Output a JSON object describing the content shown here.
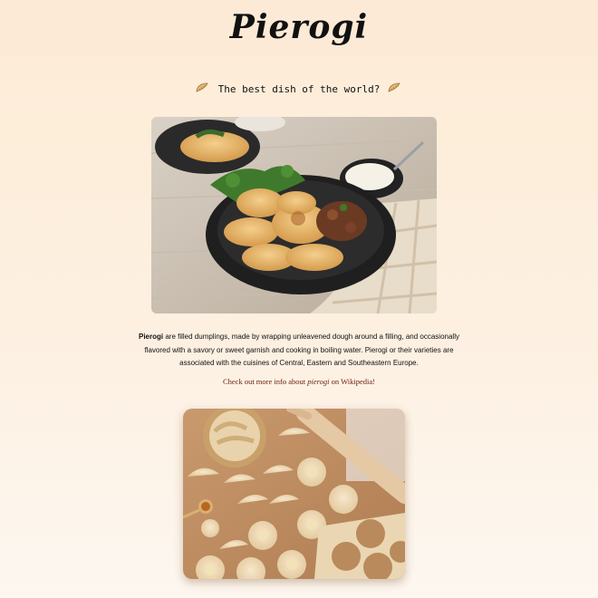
{
  "header": {
    "title": "Pierogi"
  },
  "tagline": {
    "text": "The best dish of the world?",
    "icon_left": "dumpling-icon",
    "icon_right": "dumpling-icon"
  },
  "images": {
    "top": "pierogi-bowl-photo",
    "bottom": "dough-preparation-photo"
  },
  "description": {
    "bold_term": "Pierogi",
    "text": " are filled dumplings, made by wrapping unleavened dough around a filling, and occasionally flavored with a savory or sweet garnish and cooking in boiling water. Pierogi or their varieties are associated with the cuisines of Central, Eastern and Southeastern Europe."
  },
  "wiki": {
    "prefix": "Check out more info about ",
    "term": "pierogi",
    "middle": " on ",
    "link_text": "Wikipedia",
    "suffix": "!"
  },
  "colors": {
    "background_top": "#fdecd6",
    "background_bottom": "#fdf7f0",
    "link": "#6b1d10"
  }
}
